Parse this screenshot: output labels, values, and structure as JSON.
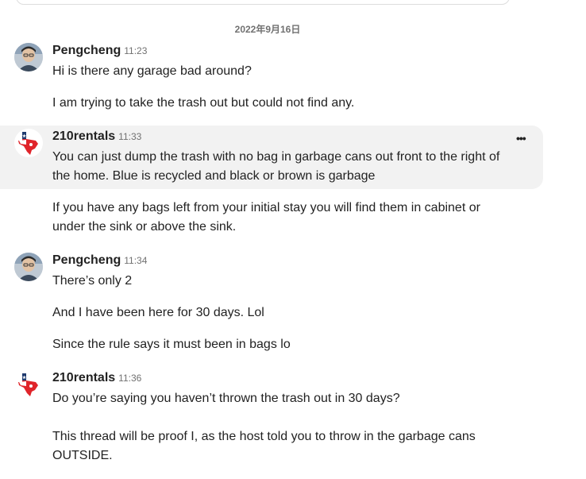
{
  "thread": {
    "date": "2022年9月16日",
    "groups": [
      {
        "sender": "Pengcheng",
        "time": "11:23",
        "messages": [
          "Hi is there any garage bad around?",
          "I am trying to take the trash out but could not find any."
        ]
      },
      {
        "sender": "210rentals",
        "time": "11:33",
        "messages": [
          "You can just dump the trash with no bag in garbage cans out front to the right of the home. Blue is recycled and black or brown is garbage",
          "If you have any bags left from your initial stay you will find them in cabinet or under the sink or above the sink."
        ]
      },
      {
        "sender": "Pengcheng",
        "time": "11:34",
        "messages": [
          "There’s only 2",
          "And I have been here for 30 days. Lol",
          "Since the rule says it must been in bags lo"
        ]
      },
      {
        "sender": "210rentals",
        "time": "11:36",
        "messages": [
          "Do you’re saying you haven’t thrown the trash out in 30 days?",
          "This thread will be proof I, as the host told you to throw in the garbage cans OUTSIDE."
        ]
      }
    ]
  },
  "icons": {
    "more": "more-options-icon",
    "guest_avatar": "user-avatar",
    "host_avatar": "texas-flag-logo"
  },
  "colors": {
    "hover_background": "#f2f2f2",
    "secondary_text": "#717171",
    "primary_text": "#222222",
    "logo_red": "#e0242a",
    "logo_navy": "#1f3a6e"
  }
}
